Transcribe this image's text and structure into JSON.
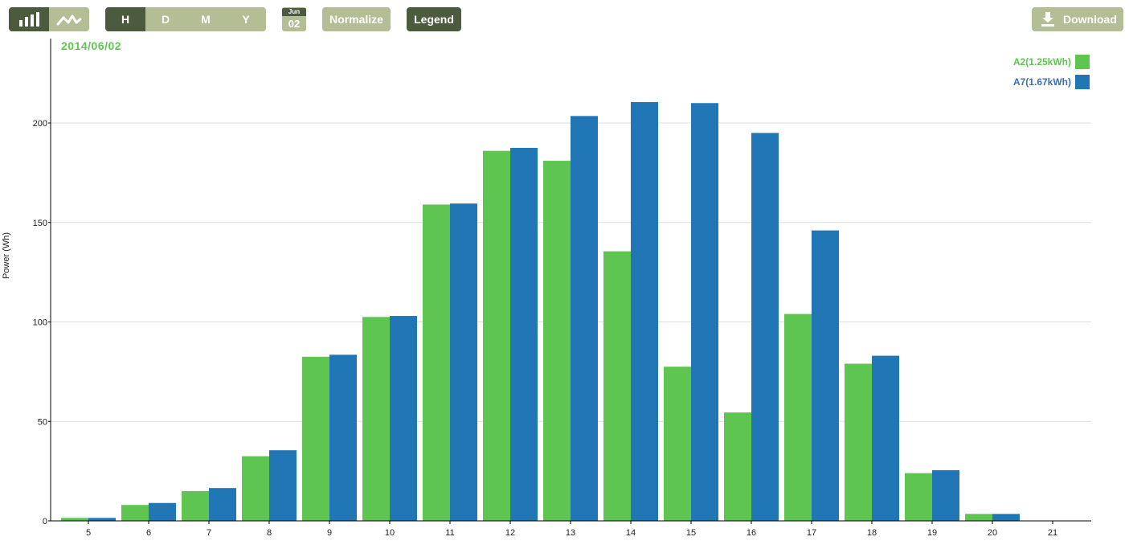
{
  "toolbar": {
    "view_toggle": [
      {
        "name": "bar-chart-view",
        "icon": "bar-chart-icon",
        "active": true
      },
      {
        "name": "line-chart-view",
        "icon": "line-chart-icon",
        "active": false
      }
    ],
    "periods": [
      "H",
      "D",
      "M",
      "Y"
    ],
    "active_period": "H",
    "date_month": "Jun",
    "date_day": "02",
    "normalize_label": "Normalize",
    "legend_label": "Legend",
    "download_label": "Download"
  },
  "colors": {
    "dark_button": "#4c5a3e",
    "light_button": "#b3be94",
    "series_a2": "#5ec650",
    "series_a7": "#2176b5"
  },
  "chart_data": {
    "type": "bar",
    "title": "2014/06/02",
    "ylabel": "Power (Wh)",
    "xlabel": "",
    "ylim": [
      0,
      240
    ],
    "yticks": [
      0,
      50,
      100,
      150,
      200
    ],
    "grid": true,
    "legend_position": "top-right",
    "categories": [
      "5",
      "6",
      "7",
      "8",
      "9",
      "10",
      "11",
      "12",
      "13",
      "14",
      "15",
      "16",
      "17",
      "18",
      "19",
      "20",
      "21"
    ],
    "series": [
      {
        "name": "A2(1.25kWh)",
        "color": "#5ec650",
        "values": [
          1.5,
          8,
          15,
          32.5,
          82.5,
          102.5,
          159,
          186,
          181,
          135.5,
          77.5,
          54.5,
          104,
          79,
          24,
          3.5,
          0
        ]
      },
      {
        "name": "A7(1.67kWh)",
        "color": "#2176b5",
        "values": [
          1.5,
          9,
          16.5,
          35.5,
          83.5,
          103,
          159.5,
          187.5,
          203.5,
          210.5,
          210,
          195,
          146,
          83,
          25.5,
          3.5,
          0
        ]
      }
    ]
  }
}
